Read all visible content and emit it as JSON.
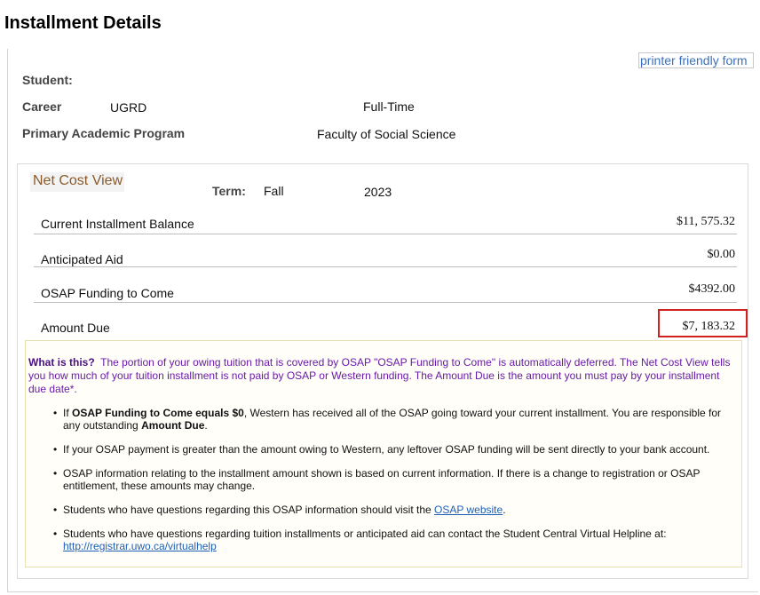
{
  "page": {
    "title": "Installment Details",
    "printer_link": "printer friendly form"
  },
  "student": {
    "label": "Student:",
    "career_label": "Career",
    "career_value": "UGRD",
    "load": "Full-Time",
    "program_label": "Primary Academic Program",
    "program_value": "Faculty of Social Science"
  },
  "net_cost": {
    "tab_label": "Net Cost View",
    "term_label": "Term:",
    "term_season": "Fall",
    "term_year": "2023",
    "rows": [
      {
        "label": "Current Installment Balance",
        "amount": "$11, 575.32"
      },
      {
        "label": "Anticipated Aid",
        "amount": "$0.00"
      },
      {
        "label": "OSAP Funding to Come",
        "amount": "$4392.00"
      },
      {
        "label": "Amount Due",
        "amount": "$7, 183.32"
      }
    ]
  },
  "info": {
    "what_heading": "What is this?",
    "what_body": "The portion of your owing tuition that is covered by OSAP \"OSAP Funding to Come\" is automatically deferred. The Net Cost View tells you how much of your tuition installment is not paid by OSAP or Western funding. The Amount Due is the amount you must pay by your installment due date*.",
    "bullet1_pre": "If ",
    "bullet1_bold1": "OSAP Funding to Come equals $0",
    "bullet1_mid": ", Western has received all of the OSAP going toward your current installment. You are responsible for any outstanding ",
    "bullet1_bold2": "Amount Due",
    "bullet1_end": ".",
    "bullet2": "If your OSAP payment is greater than the amount owing to Western, any leftover OSAP funding will be sent directly to your bank account.",
    "bullet3": "OSAP information relating to the installment amount shown is based on current information. If there is a change to registration or OSAP entitlement, these amounts may change.",
    "bullet4_pre": "Students who have questions regarding this OSAP information should visit the ",
    "bullet4_link": "OSAP website",
    "bullet4_end": ".",
    "bullet5": "Students who have questions regarding tuition installments or anticipated aid can contact the Student Central Virtual Helpline at:",
    "bullet5_link": "http://registrar.uwo.ca/virtualhelp"
  },
  "colors": {
    "highlight": "#d02020",
    "info_text": "#6a1aa8",
    "link": "#1f5fb5",
    "tab_text": "#8a5a2b"
  }
}
